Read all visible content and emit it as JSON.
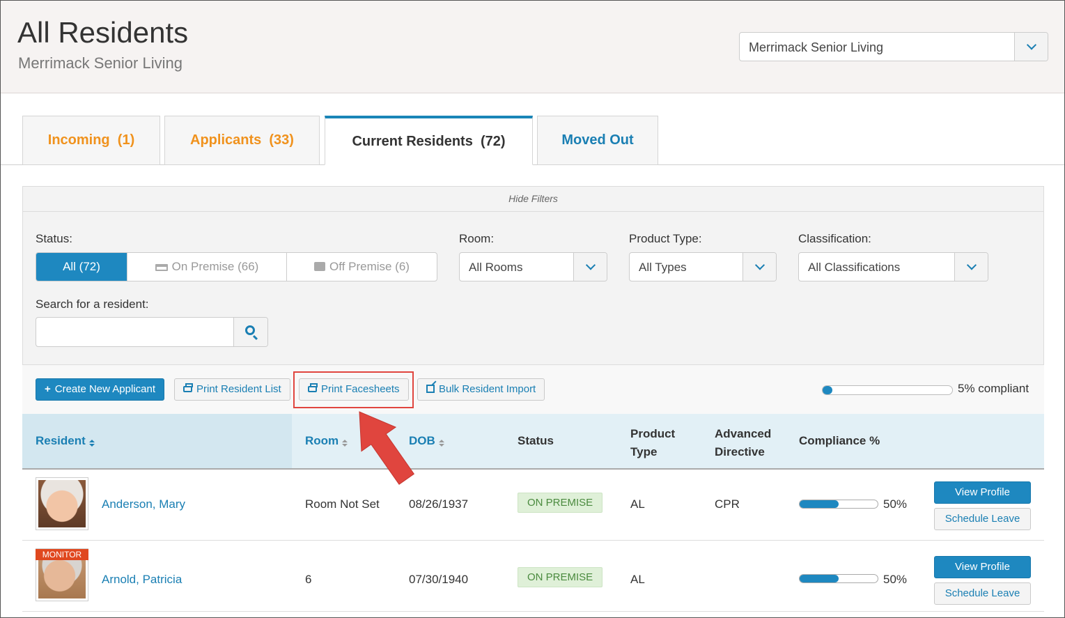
{
  "header": {
    "title": "All Residents",
    "subtitle": "Merrimack Senior Living",
    "community_select": "Merrimack Senior Living"
  },
  "tabs": [
    {
      "label": "Incoming",
      "count": "(1)"
    },
    {
      "label": "Applicants",
      "count": "(33)"
    },
    {
      "label": "Current Residents",
      "count": "(72)"
    },
    {
      "label": "Moved Out",
      "count": ""
    }
  ],
  "filters": {
    "hide_label": "Hide Filters",
    "status_label": "Status:",
    "status_options": [
      "All (72)",
      "On Premise (66)",
      "Off Premise (6)"
    ],
    "room_label": "Room:",
    "room_value": "All Rooms",
    "product_label": "Product Type:",
    "product_value": "All Types",
    "class_label": "Classification:",
    "class_value": "All Classifications",
    "search_label": "Search for a resident:",
    "search_value": ""
  },
  "toolbar": {
    "create_label": "Create New Applicant",
    "print_list_label": "Print Resident List",
    "print_facesheets_label": "Print Facesheets",
    "bulk_import_label": "Bulk Resident Import",
    "compliance_text": "5% compliant",
    "compliance_fraction": 0.05
  },
  "table": {
    "headers": {
      "resident": "Resident",
      "room": "Room",
      "dob": "DOB",
      "status": "Status",
      "product_l1": "Product",
      "product_l2": "Type",
      "directive_l1": "Advanced",
      "directive_l2": "Directive",
      "compliance": "Compliance %"
    },
    "rows": [
      {
        "name": "Anderson, Mary",
        "room": "Room Not Set",
        "dob": "08/26/1937",
        "status": "ON PREMISE",
        "product": "AL",
        "directive": "CPR",
        "compliance": "50%",
        "compliance_fraction": 0.5,
        "flag": ""
      },
      {
        "name": "Arnold, Patricia",
        "room": "6",
        "dob": "07/30/1940",
        "status": "ON PREMISE",
        "product": "AL",
        "directive": "",
        "compliance": "50%",
        "compliance_fraction": 0.5,
        "flag": "MONITOR"
      }
    ],
    "view_label": "View Profile",
    "leave_label": "Schedule Leave"
  },
  "colors": {
    "accent": "#1e88c0",
    "tab_orange": "#f0921d",
    "annotation_red": "#e0453e",
    "status_green": "#dff0d8"
  }
}
